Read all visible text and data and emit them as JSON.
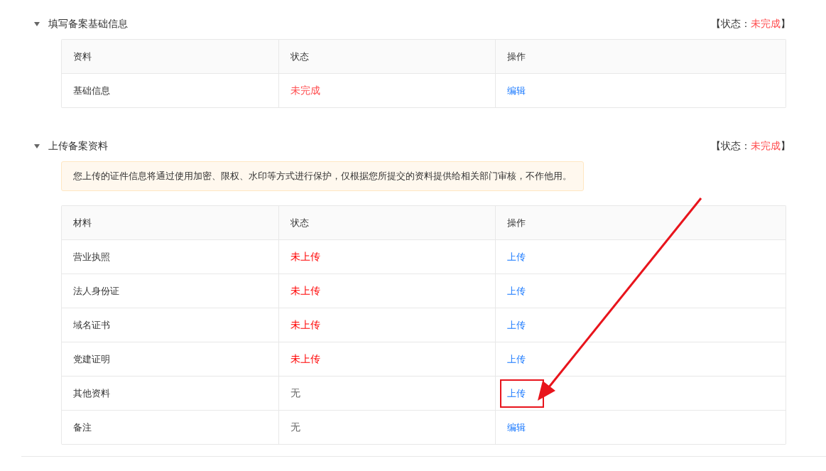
{
  "sections": [
    {
      "title": "填写备案基础信息",
      "expanded": true,
      "status_label": "【状态：",
      "status_value": "未完成",
      "status_close": "】",
      "table": {
        "columns": [
          "资料",
          "状态",
          "操作"
        ],
        "rows": [
          {
            "item": "基础信息",
            "status": "未完成",
            "color": "#ff4d4f",
            "action": "编辑",
            "highlighted": false
          }
        ]
      }
    },
    {
      "title": "上传备案资料",
      "expanded": true,
      "status_label": "【状态：",
      "status_value": "未完成",
      "status_close": "】",
      "notice": "您上传的证件信息将通过使用加密、限权、水印等方式进行保护，仅根据您所提交的资料提供给相关部门审核，不作他用。",
      "table": {
        "columns": [
          "材料",
          "状态",
          "操作"
        ],
        "rows": [
          {
            "item": "营业执照",
            "status": "未上传",
            "color": "#ff0000",
            "action": "上传",
            "highlighted": false
          },
          {
            "item": "法人身份证",
            "status": "未上传",
            "color": "#ff0000",
            "action": "上传",
            "highlighted": false
          },
          {
            "item": "域名证书",
            "status": "未上传",
            "color": "#ff0000",
            "action": "上传",
            "highlighted": false
          },
          {
            "item": "党建证明",
            "status": "未上传",
            "color": "#ff0000",
            "action": "上传",
            "highlighted": false
          },
          {
            "item": "其他资料",
            "status": "无",
            "color": "#666666",
            "action": "上传",
            "highlighted": true
          },
          {
            "item": "备注",
            "status": "无",
            "color": "#666666",
            "action": "编辑",
            "highlighted": false
          }
        ]
      }
    }
  ]
}
